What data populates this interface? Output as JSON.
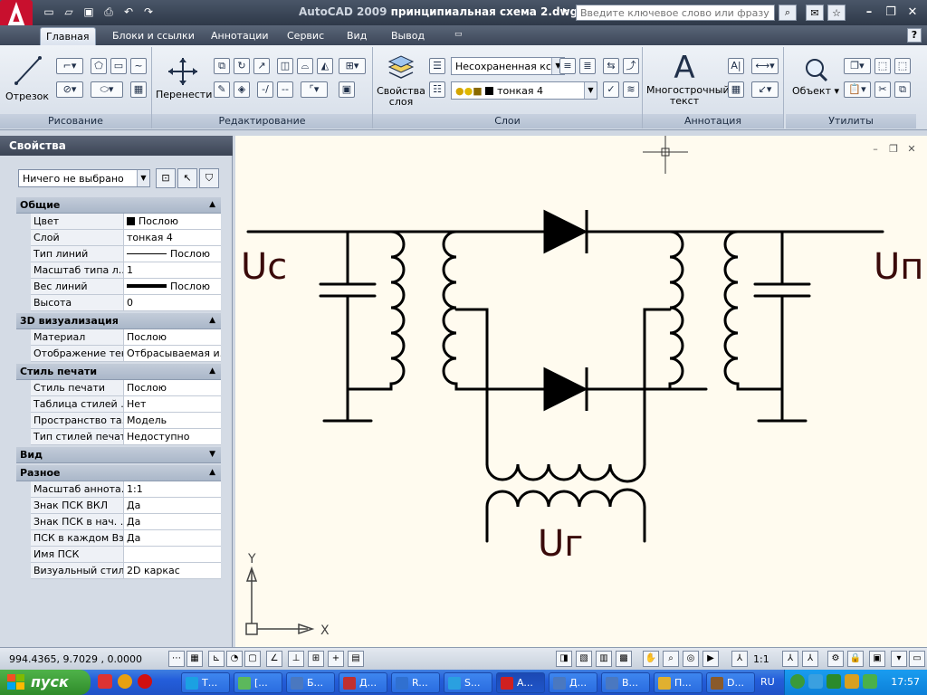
{
  "title": {
    "app": "AutoCAD 2009",
    "document": "принципиальная схема 2.dwg"
  },
  "search": {
    "placeholder": "Введите ключевое слово или фразу"
  },
  "tabs": [
    "Главная",
    "Блоки и ссылки",
    "Аннотации",
    "Сервис",
    "Вид",
    "Вывод"
  ],
  "ribbon": {
    "panels": {
      "draw": "Рисование",
      "modify": "Редактирование",
      "layers": "Слои",
      "annotation": "Аннотация",
      "utilities": "Утилиты"
    },
    "line_btn": "Отрезок",
    "move_btn": "Перенести",
    "layer_props_btn": "Свойства слоя",
    "layer_state": "Несохраненная кс",
    "current_layer": "тонкая 4",
    "mtext_btn": "Многострочный текст",
    "object_btn": "Объект"
  },
  "properties": {
    "title": "Свойства",
    "selection": "Ничего не выбрано",
    "sections": [
      {
        "name": "Общие",
        "collapsed": false,
        "rows": [
          {
            "k": "Цвет",
            "v": "Послою",
            "swatch": true
          },
          {
            "k": "Слой",
            "v": "тонкая 4"
          },
          {
            "k": "Тип линий",
            "v": "Послою",
            "line": "thin"
          },
          {
            "k": "Масштаб типа л...",
            "v": "1"
          },
          {
            "k": "Вес линий",
            "v": "Послою",
            "line": "thick"
          },
          {
            "k": "Высота",
            "v": "0"
          }
        ]
      },
      {
        "name": "3D визуализация",
        "collapsed": false,
        "rows": [
          {
            "k": "Материал",
            "v": "Послою"
          },
          {
            "k": "Отображение тени",
            "v": "Отбрасываемая и..."
          }
        ]
      },
      {
        "name": "Стиль печати",
        "collapsed": false,
        "rows": [
          {
            "k": "Стиль печати",
            "v": "Послою"
          },
          {
            "k": "Таблица стилей ...",
            "v": "Нет"
          },
          {
            "k": "Пространство та...",
            "v": "Модель"
          },
          {
            "k": "Тип стилей печати",
            "v": "Недоступно"
          }
        ]
      },
      {
        "name": "Вид",
        "collapsed": true,
        "rows": []
      },
      {
        "name": "Разное",
        "collapsed": false,
        "rows": [
          {
            "k": "Масштаб аннота...",
            "v": "1:1"
          },
          {
            "k": "Знак ПСК ВКЛ",
            "v": "Да"
          },
          {
            "k": "Знак ПСК в нач. ...",
            "v": "Да"
          },
          {
            "k": "ПСК в каждом Вэ...",
            "v": "Да"
          },
          {
            "k": "Имя ПСК",
            "v": ""
          },
          {
            "k": "Визуальный стиль",
            "v": "2D каркас"
          }
        ]
      }
    ]
  },
  "drawing": {
    "label_uc": "Uc",
    "label_un": "Uп",
    "label_ug": "Uг",
    "axis_x": "X",
    "axis_y": "Y"
  },
  "status": {
    "coords": "994.4365, 9.7029 , 0.0000",
    "annotation_scale": "1:1"
  },
  "taskbar": {
    "start": "пуск",
    "tasks": [
      "Т...",
      "[...",
      "Б...",
      "Д...",
      "R...",
      "S...",
      "A...",
      "Д...",
      "В...",
      "П...",
      "D..."
    ],
    "lang": "RU",
    "time": "17:57"
  },
  "colors": {
    "canvas_bg": "#fffbef",
    "schematic_stroke": "#000000",
    "label_text": "#3a0a0a",
    "app_red": "#c8102e"
  }
}
